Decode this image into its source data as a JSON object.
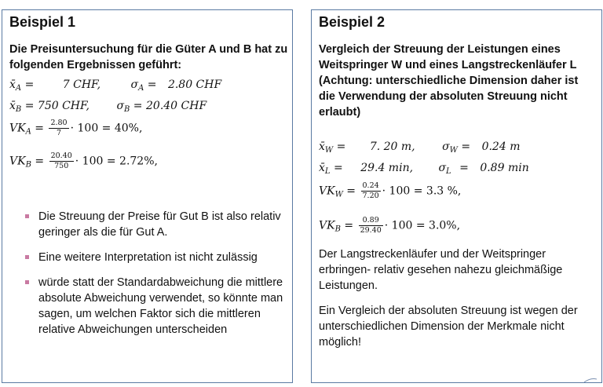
{
  "ex1": {
    "title": "Beispiel 1",
    "subtitle": "Die Preisuntersuchung für die Güter A und B hat zu folgenden Ergebnissen geführt:",
    "line1_mean": "7 CHF,",
    "line1_sigma": "2.80 CHF",
    "line2_mean": "750 CHF,",
    "line2_sigma": "20.40 CHF",
    "vka_num": "2.80",
    "vka_den": "7",
    "vka_result": "· 100 = 40%,",
    "vkb_num": "20.40",
    "vkb_den": "750",
    "vkb_result": "· 100 = 2.72%,",
    "bullets": [
      "Die Streuung der Preise für Gut B ist also relativ geringer als die für Gut A.",
      "Eine weitere Interpretation ist nicht zulässig",
      "würde statt der Standardabweichung die mittlere absolute Abweichung verwendet, so könnte man sagen, um welchen Faktor sich die mittleren relative Abweichungen unterscheiden"
    ]
  },
  "ex2": {
    "title": "Beispiel 2",
    "subtitle": "Vergleich der Streuung  der Leistungen eines Weitspringer W und eines Langstreckenläufer L (Achtung: unterschiedliche Dimension daher ist die Verwendung der absoluten Streuung nicht erlaubt)",
    "line1_mean": "7. 20 m,",
    "line1_sigma": "0.24 m",
    "line2_mean": "29.4 min,",
    "line2_sigma": "0.89  min",
    "vkw_num": "0.24",
    "vkw_den": "7.20",
    "vkw_result": "· 100 = 3.3 %,",
    "vkb_num": "0.89",
    "vkb_den": "29.40",
    "vkb_result": "· 100 = 3.0%,",
    "para1": "Der Langstreckenläufer und der Weitspringer erbringen- relativ gesehen nahezu gleichmäßige Leistungen.",
    "para2": "Ein Vergleich der absoluten Streuung ist wegen der unterschiedlichen Dimension der Merkmale nicht möglich!"
  },
  "colors": {
    "border": "#5a7aa2",
    "bullet": "#c97aa2"
  }
}
